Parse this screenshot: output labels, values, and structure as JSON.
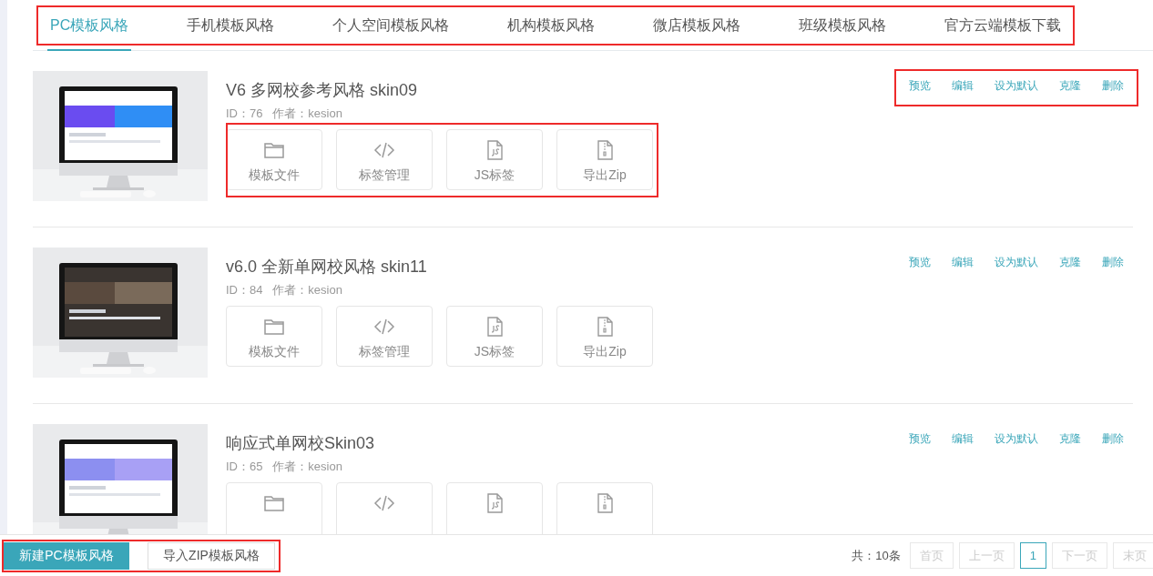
{
  "tabs": {
    "highlighted": true,
    "items": [
      {
        "label": "PC模板风格",
        "selected": true
      },
      {
        "label": "手机模板风格",
        "selected": false
      },
      {
        "label": "个人空间模板风格",
        "selected": false
      },
      {
        "label": "机构模板风格",
        "selected": false
      },
      {
        "label": "微店模板风格",
        "selected": false
      },
      {
        "label": "班级模板风格",
        "selected": false
      },
      {
        "label": "官方云端模板下载",
        "selected": false
      }
    ]
  },
  "templates": [
    {
      "thumbnail": {
        "kind": "picture"
      },
      "title": "V6 多网校参考风格 skin09",
      "meta": "ID：76   作者：kesion",
      "actions_highlighted": true,
      "actions": [
        "预览",
        "编辑",
        "设为默认",
        "克隆",
        "删除"
      ],
      "tools_highlighted": true,
      "tools": [
        {
          "kind": "folder",
          "label": "模板文件"
        },
        {
          "kind": "code",
          "label": "标签管理"
        },
        {
          "kind": "js",
          "label": "JS标签"
        },
        {
          "kind": "zip",
          "label": "导出Zip"
        }
      ]
    },
    {
      "thumbnail": {
        "kind": "picture"
      },
      "title": "v6.0 全新单网校风格 skin11",
      "meta": "ID：84   作者：kesion",
      "actions_highlighted": false,
      "actions": [
        "预览",
        "编辑",
        "设为默认",
        "克隆",
        "删除"
      ],
      "tools_highlighted": false,
      "tools": [
        {
          "kind": "folder",
          "label": "模板文件"
        },
        {
          "kind": "code",
          "label": "标签管理"
        },
        {
          "kind": "js",
          "label": "JS标签"
        },
        {
          "kind": "zip",
          "label": "导出Zip"
        }
      ]
    },
    {
      "thumbnail": {
        "kind": "picture"
      },
      "title": "响应式单网校Skin03",
      "meta": "ID：65   作者：kesion",
      "actions_highlighted": false,
      "actions": [
        "预览",
        "编辑",
        "设为默认",
        "克隆",
        "删除"
      ],
      "tools_highlighted": false,
      "tools": [
        {
          "kind": "folder"
        },
        {
          "kind": "code"
        },
        {
          "kind": "js"
        },
        {
          "kind": "zip"
        }
      ]
    }
  ],
  "footer": {
    "buttons_highlighted": true,
    "buttons": [
      {
        "label": "新建PC模板风格",
        "kind": "primary"
      },
      {
        "label": "导入ZIP模板风格",
        "kind": "default"
      }
    ],
    "total": "共：10条",
    "pager": [
      {
        "label": "首页",
        "disabled": true,
        "selected": false
      },
      {
        "label": "上一页",
        "disabled": true,
        "selected": false
      },
      {
        "label": "1",
        "disabled": false,
        "selected": true
      },
      {
        "label": "下一页",
        "disabled": true,
        "selected": false
      },
      {
        "label": "末页",
        "disabled": true,
        "selected": false
      }
    ]
  }
}
